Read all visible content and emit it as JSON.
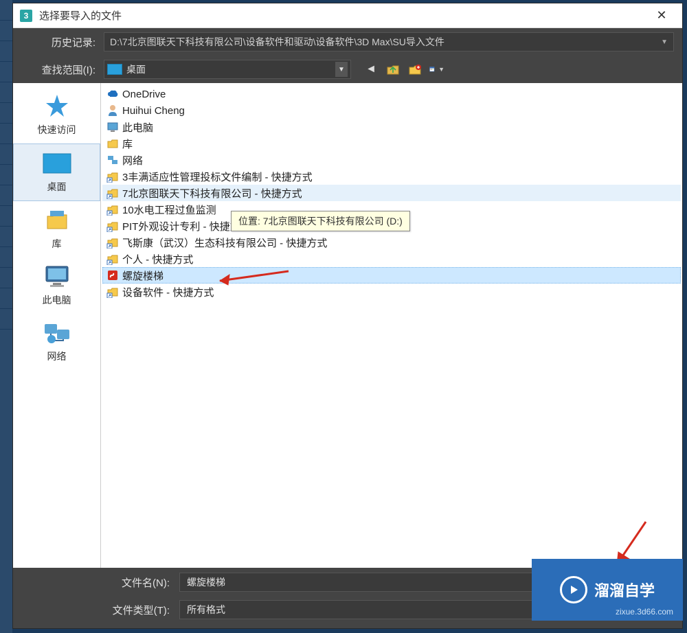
{
  "window": {
    "title": "选择要导入的文件",
    "app_glyph": "3"
  },
  "history": {
    "label": "历史记录:",
    "path": "D:\\7北京图联天下科技有限公司\\设备软件和驱动\\设备软件\\3D Max\\SU导入文件"
  },
  "lookin": {
    "label": "查找范围(I):",
    "value": "桌面"
  },
  "sidebar": {
    "items": [
      {
        "id": "quick",
        "label": "快速访问"
      },
      {
        "id": "desktop",
        "label": "桌面"
      },
      {
        "id": "libraries",
        "label": "库"
      },
      {
        "id": "thispc",
        "label": "此电脑"
      },
      {
        "id": "network",
        "label": "网络"
      }
    ]
  },
  "files": [
    {
      "icon": "onedrive",
      "label": "OneDrive"
    },
    {
      "icon": "user",
      "label": "Huihui Cheng"
    },
    {
      "icon": "thispc",
      "label": "此电脑"
    },
    {
      "icon": "libraries",
      "label": "库"
    },
    {
      "icon": "network",
      "label": "网络"
    },
    {
      "icon": "shortcut",
      "label": "3丰满适应性管理投标文件编制 - 快捷方式"
    },
    {
      "icon": "shortcut",
      "label": "7北京图联天下科技有限公司 - 快捷方式",
      "hovered": true
    },
    {
      "icon": "shortcut",
      "label": "10水电工程过鱼监测",
      "truncated": true
    },
    {
      "icon": "shortcut",
      "label": "PIT外观设计专利 - 快捷方式"
    },
    {
      "icon": "shortcut",
      "label": "飞斯康（武汉）生态科技有限公司 - 快捷方式"
    },
    {
      "icon": "shortcut",
      "label": "个人 - 快捷方式"
    },
    {
      "icon": "skp",
      "label": "螺旋楼梯",
      "selected": true
    },
    {
      "icon": "shortcut",
      "label": "设备软件 - 快捷方式"
    }
  ],
  "tooltip": "位置: 7北京图联天下科技有限公司 (D:)",
  "filename": {
    "label": "文件名(N):",
    "value": "螺旋楼梯"
  },
  "filetype": {
    "label": "文件类型(T):",
    "value": "所有格式"
  },
  "watermark": {
    "brand": "溜溜自学",
    "site": "zixue.3d66.com"
  }
}
